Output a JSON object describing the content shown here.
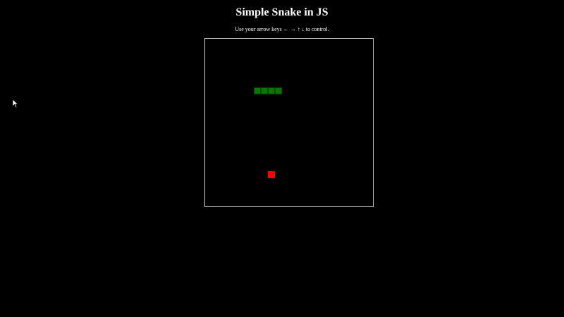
{
  "page": {
    "title": "Simple Snake in JS",
    "instructions": "Use your arrow keys ← → ↑ ↓ to control."
  },
  "game": {
    "board_columns": 24,
    "board_rows": 24,
    "snake": [
      {
        "col": 7,
        "row": 7
      },
      {
        "col": 8,
        "row": 7
      },
      {
        "col": 9,
        "row": 7
      },
      {
        "col": 10,
        "row": 7
      }
    ],
    "food": {
      "col": 9,
      "row": 19
    },
    "colors": {
      "background": "#000000",
      "border": "#d0d0d0",
      "snake": "#007a00",
      "food": "#ff0000"
    }
  },
  "icons": {
    "cursor": "mouse-pointer-icon"
  }
}
